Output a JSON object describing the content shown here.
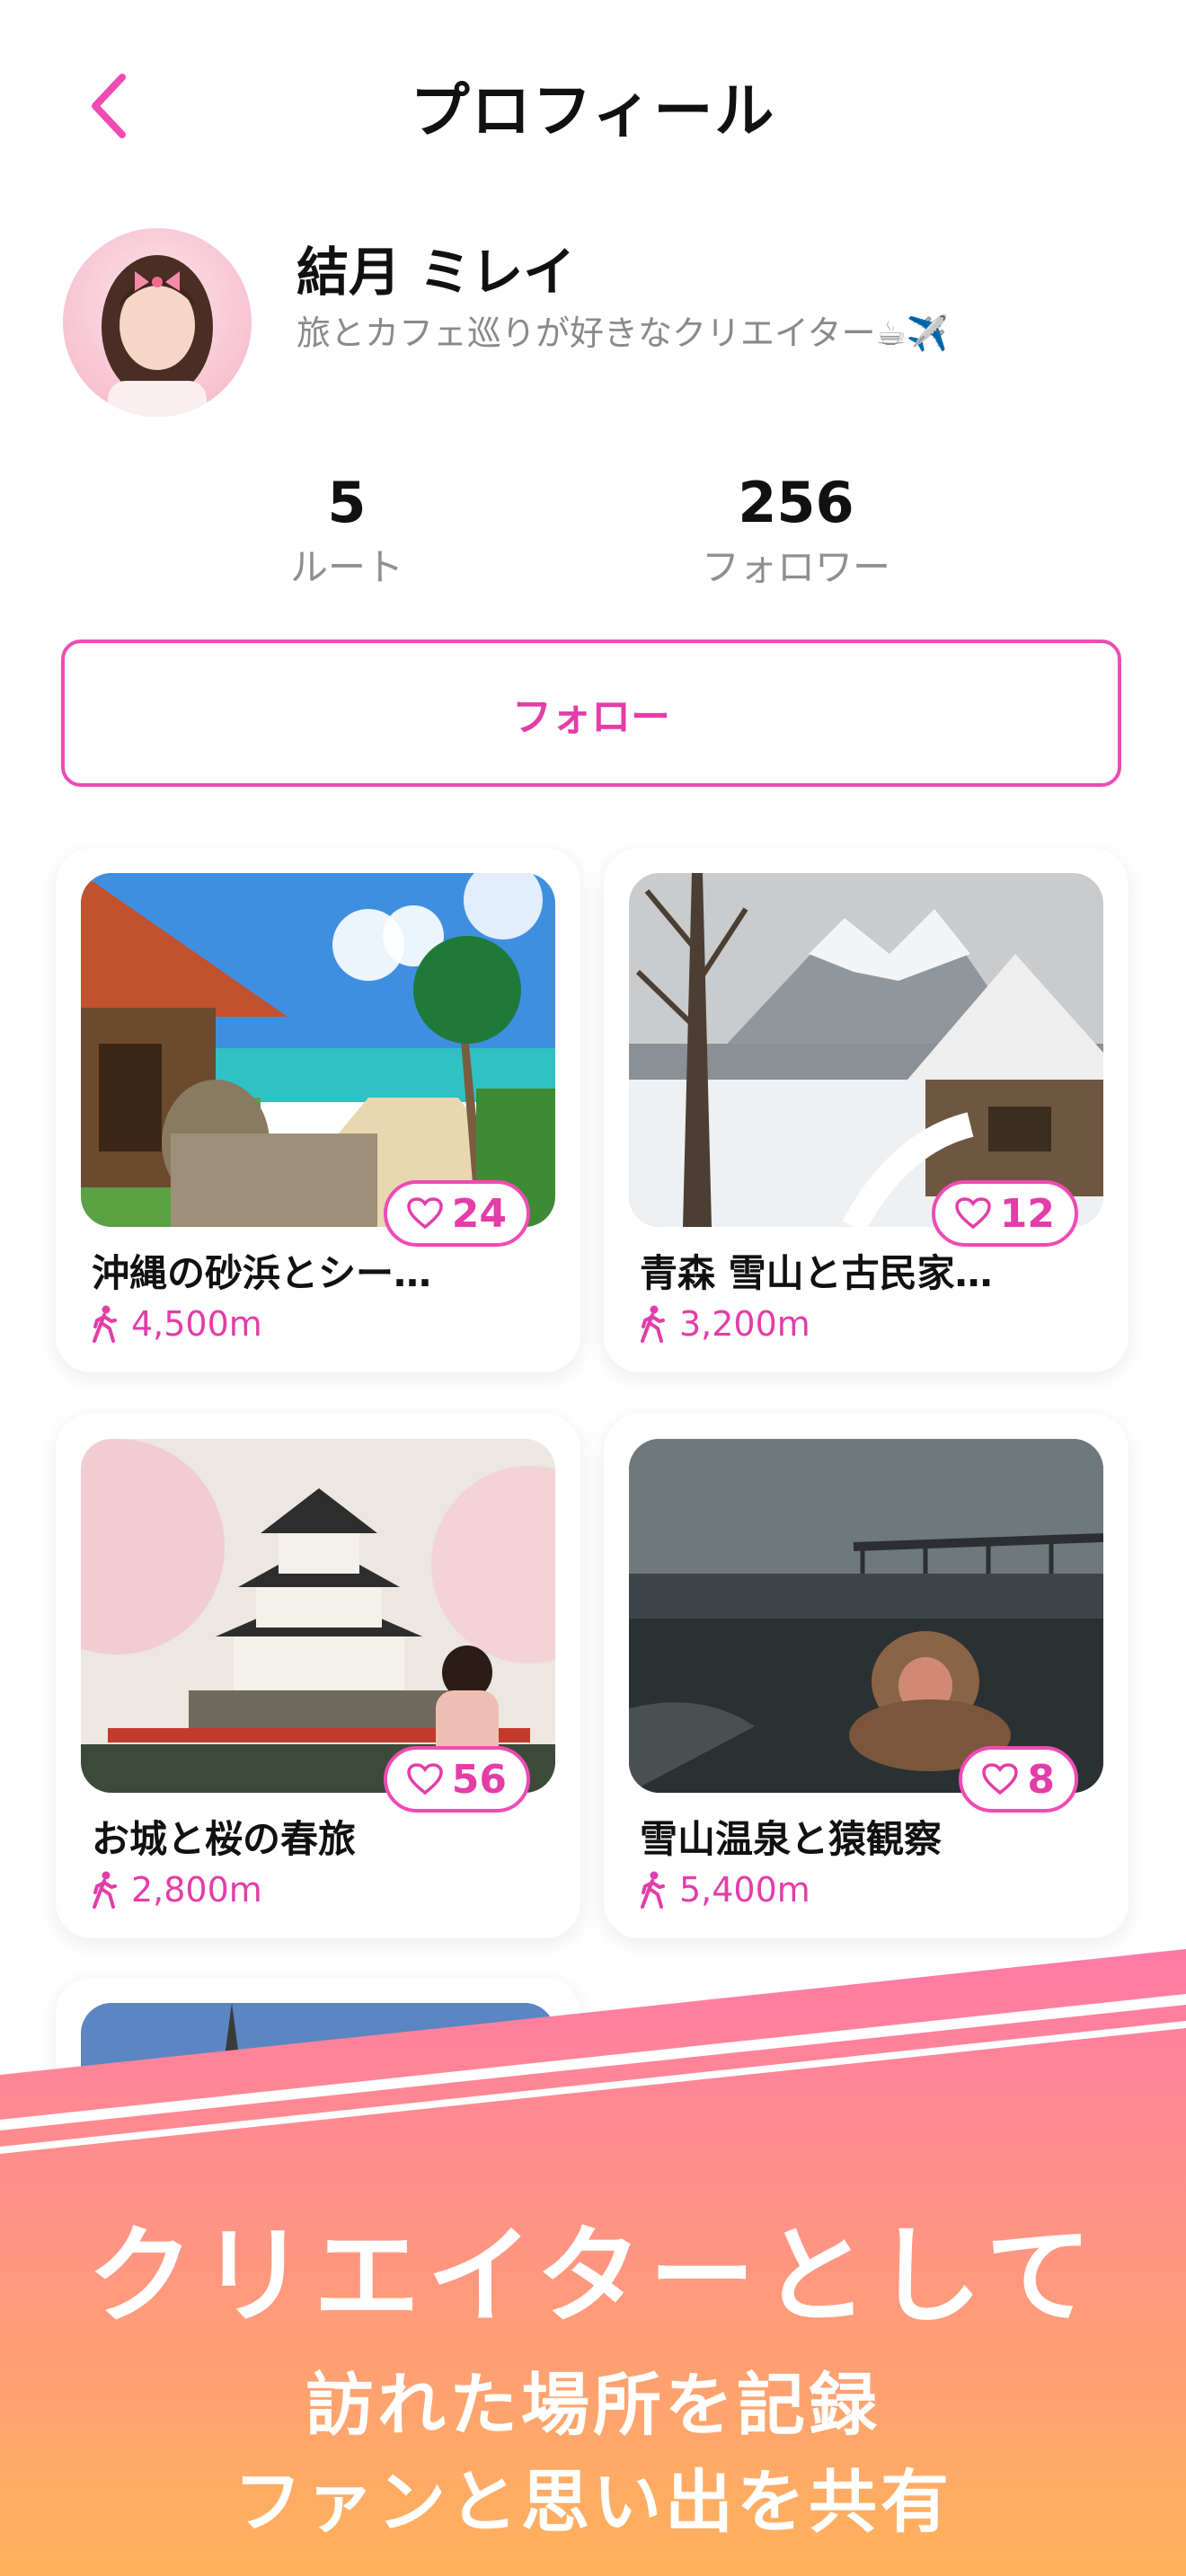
{
  "header": {
    "title": "プロフィール"
  },
  "profile": {
    "name": "結月 ミレイ",
    "bio": "旅とカフェ巡りが好きなクリエイター☕✈️"
  },
  "stats": {
    "routes": {
      "value": "5",
      "label": "ルート"
    },
    "followers": {
      "value": "256",
      "label": "フォロワー"
    }
  },
  "follow_button": {
    "label": "フォロー"
  },
  "routes": [
    {
      "title": "沖縄の砂浜とシー…",
      "likes": "24",
      "distance": "4,500m"
    },
    {
      "title": "青森 雪山と古民家…",
      "likes": "12",
      "distance": "3,200m"
    },
    {
      "title": "お城と桜の春旅",
      "likes": "56",
      "distance": "2,800m"
    },
    {
      "title": "雪山温泉と猿観察",
      "likes": "8",
      "distance": "5,400m"
    }
  ],
  "promo": {
    "headline": "クリエイターとして",
    "line1": "訪れた場所を記録",
    "line2": "ファンと思い出を共有"
  },
  "colors": {
    "accent": "#ef4bb3",
    "banner_top": "#ff7aa6",
    "banner_bottom": "#ffb35a"
  },
  "icons": [
    "back-chevron-icon",
    "heart-icon",
    "walking-icon"
  ]
}
